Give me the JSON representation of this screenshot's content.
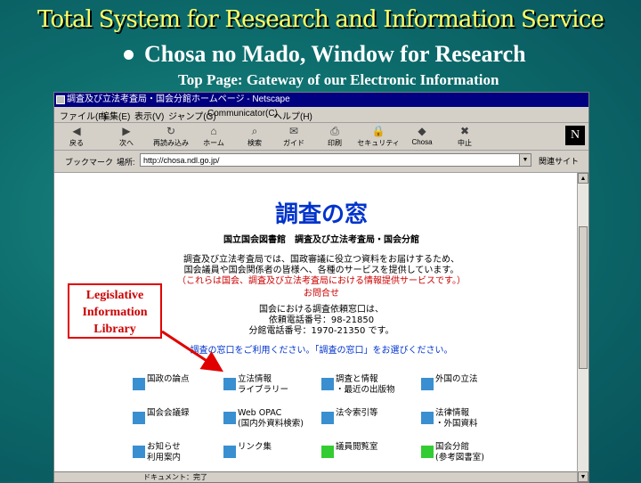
{
  "slide": {
    "title": "Total System for Research and Information Service",
    "bullet": "Chosa no Mado, Window for Research",
    "subbullet": "Top Page: Gateway of our Electronic Information"
  },
  "browser": {
    "title": "調査及び立法考査局・国会分館ホームページ - Netscape",
    "menu": [
      "ファイル(F)",
      "編集(E)",
      "表示(V)",
      "ジャンプ(G)",
      "Communicator(C)",
      "ヘルプ(H)"
    ],
    "toolbar": [
      {
        "label": "戻る",
        "icon": "back-arrow-icon",
        "glyph": "◀"
      },
      {
        "label": "次へ",
        "icon": "forward-arrow-icon",
        "glyph": "▶"
      },
      {
        "label": "再読み込み",
        "icon": "reload-icon",
        "glyph": "↻"
      },
      {
        "label": "ホーム",
        "icon": "home-icon",
        "glyph": "⌂"
      },
      {
        "label": "検索",
        "icon": "search-icon",
        "glyph": "⌕"
      },
      {
        "label": "ガイド",
        "icon": "guide-icon",
        "glyph": "✉"
      },
      {
        "label": "印刷",
        "icon": "print-icon",
        "glyph": "⎙"
      },
      {
        "label": "セキュリティ",
        "icon": "security-icon",
        "glyph": "🔒"
      },
      {
        "label": "Chosa",
        "icon": "chosa-icon",
        "glyph": "◆"
      },
      {
        "label": "中止",
        "icon": "stop-icon",
        "glyph": "✖"
      }
    ],
    "bookmarks_label": "ブックマーク",
    "location_label": "場所:",
    "url": "http://chosa.ndl.go.jp/",
    "related_label": "関連サイト"
  },
  "page": {
    "heading": "調査の窓",
    "org": "国立国会図書館　調査及び立法考査局・国会分館",
    "intro": [
      "調査及び立法考査局では、国政審議に役立つ資料をお届けするため、",
      "国会議員や国会関係者の皆様へ、各種のサービスを提供しています。",
      "（これらは国会、調査及び立法考査局における情報提供サービスです。）"
    ],
    "contact_label": "お問合せ",
    "contact": [
      "国会における調査依頼窓口は、",
      "依頼電話番号：98-21850",
      "分館電話番号：1970-21350 です。"
    ],
    "notice": "調査の窓口をご利用ください。「調査の窓口」をお選びください。",
    "nav": [
      {
        "label": "国政の論点",
        "accent": "#3a8fd0"
      },
      {
        "label": "立法情報\nライブラリー",
        "accent": "#3a8fd0"
      },
      {
        "label": "調査と情報\n・最近の出版物",
        "accent": "#3a8fd0"
      },
      {
        "label": "外国の立法",
        "accent": "#3a8fd0"
      },
      {
        "label": "国会会議録",
        "accent": "#3a8fd0"
      },
      {
        "label": "Web OPAC\n(国内外資料検索)",
        "accent": "#3a8fd0"
      },
      {
        "label": "法令索引等",
        "accent": "#3a8fd0"
      },
      {
        "label": "法律情報\n・外国資料",
        "accent": "#3a8fd0"
      },
      {
        "label": "お知らせ\n利用案内",
        "accent": "#3a8fd0"
      },
      {
        "label": "リンク集",
        "accent": "#3a8fd0"
      },
      {
        "label": "議員閲覧室",
        "accent": "#33cc33"
      },
      {
        "label": "国会分館\n(参考図書室)",
        "accent": "#33cc33"
      }
    ],
    "status": "ドキュメント：完了"
  },
  "callout": "Legislative Information Library",
  "colors": {
    "slide_bg": "#0d6d6d",
    "title": "#ffff66",
    "heading": "#0033cc",
    "callout": "#cc0000",
    "nav_blue": "#3a8fd0",
    "nav_green": "#33cc33"
  }
}
